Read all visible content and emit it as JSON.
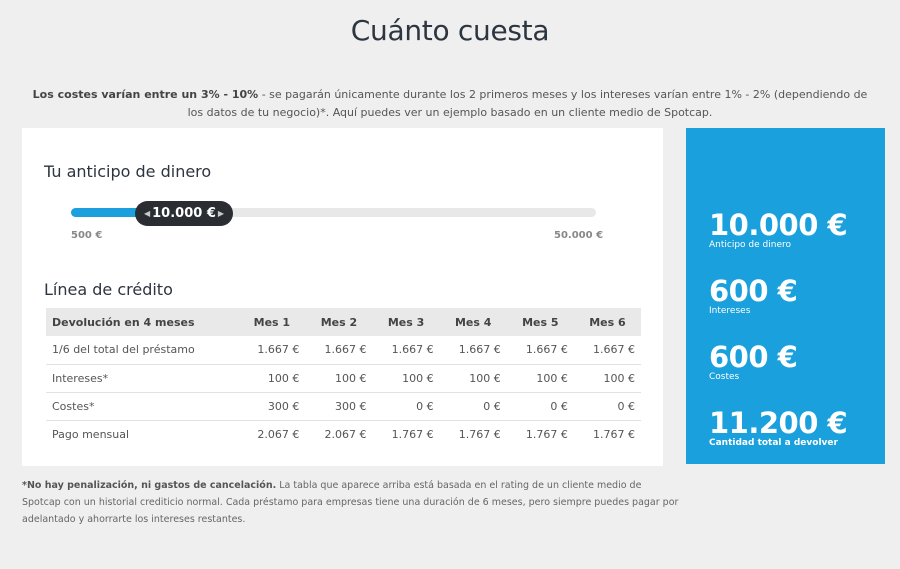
{
  "page": {
    "title": "Cuánto cuesta",
    "intro_bold": "Los costes varían entre un 3% - 10%",
    "intro_text": " - se pagarán únicamente durante los 2 primeros meses y los intereses varían entre 1% - 2% (dependiendo de los datos de tu negocio)*. Aquí puedes ver un ejemplo basado en un cliente medio de Spotcap."
  },
  "advance": {
    "heading": "Tu anticipo de dinero",
    "slider_value": "10.000 €",
    "slider_level_percent": 12,
    "min_label": "500 €",
    "max_label": "50.000 €"
  },
  "credit": {
    "heading": "Línea de crédito",
    "columns": [
      "Devolución en 4 meses",
      "Mes 1",
      "Mes 2",
      "Mes 3",
      "Mes 4",
      "Mes 5",
      "Mes 6"
    ],
    "rows": [
      [
        "1/6 del total del préstamo",
        "1.667 €",
        "1.667 €",
        "1.667 €",
        "1.667 €",
        "1.667 €",
        "1.667 €"
      ],
      [
        "Intereses*",
        "100 €",
        "100 €",
        "100 €",
        "100 €",
        "100 €",
        "100 €"
      ],
      [
        "Costes*",
        "300 €",
        "300 €",
        "0 €",
        "0 €",
        "0 €",
        "0 €"
      ],
      [
        "Pago mensual",
        "2.067 €",
        "2.067 €",
        "1.767 €",
        "1.767 €",
        "1.767 €",
        "1.767 €"
      ]
    ]
  },
  "summary": {
    "items": [
      {
        "value": "10.000 €",
        "label": "Anticipo de dinero"
      },
      {
        "value": "600 €",
        "label": "Intereses"
      },
      {
        "value": "600 €",
        "label": "Costes"
      },
      {
        "value": "11.200 €",
        "label": "Cantidad total a devolver"
      }
    ],
    "color": "#1aa0dc"
  },
  "footnote": {
    "bold": "*No hay penalización, ni gastos de cancelación.",
    "text": " La tabla que aparece arriba está basada en el rating de un cliente medio de Spotcap con un historial crediticio normal. Cada préstamo para empresas tiene una duración de 6 meses, pero siempre puedes pagar por adelantado y ahorrarte los intereses restantes."
  }
}
